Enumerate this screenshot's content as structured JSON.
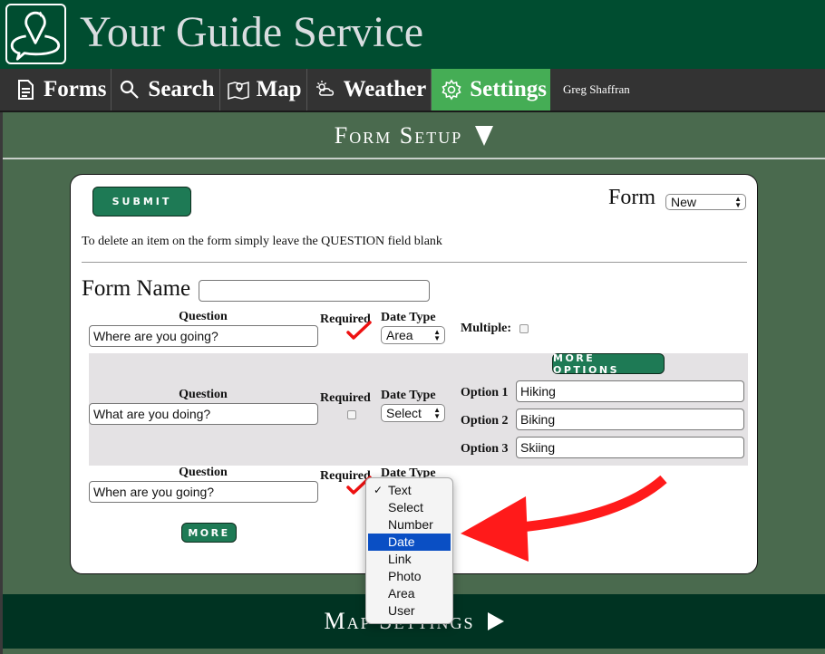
{
  "app": {
    "title": "Your Guide Service",
    "logo_icon": "map-pin-chat-logo"
  },
  "nav": {
    "items": [
      {
        "label": "Forms",
        "icon": "document-icon",
        "active": false
      },
      {
        "label": "Search",
        "icon": "search-icon",
        "active": false
      },
      {
        "label": "Map",
        "icon": "map-icon",
        "active": false
      },
      {
        "label": "Weather",
        "icon": "weather-icon",
        "active": false
      },
      {
        "label": "Settings",
        "icon": "gear-icon",
        "active": true
      }
    ],
    "user_name": "Greg Shaffran",
    "active_color": "#45ad55"
  },
  "sections": {
    "form_setup": {
      "label": "Form Setup",
      "state": "expanded"
    },
    "map_settings": {
      "label": "Map Settings",
      "state": "collapsed"
    }
  },
  "form_setup": {
    "submit_label": "SUBMIT",
    "form_select_label": "Form",
    "form_select_value": "New",
    "delete_note": "To delete an item on the form simply leave the QUESTION field blank",
    "form_name_label": "Form Name",
    "form_name_value": "",
    "column_labels": {
      "question": "Question",
      "required": "Required",
      "date_type": "Date Type",
      "multiple": "Multiple:"
    },
    "questions": [
      {
        "question": "Where are you going?",
        "required": true,
        "date_type": "Area",
        "multiple": false
      },
      {
        "question": "What are you doing?",
        "required": false,
        "date_type": "Select",
        "more_options_label": "MORE OPTIONS",
        "options": [
          {
            "label": "Option 1",
            "value": "Hiking"
          },
          {
            "label": "Option 2",
            "value": "Biking"
          },
          {
            "label": "Option 3",
            "value": "Skiing"
          }
        ]
      },
      {
        "question": "When are you going?",
        "required": true,
        "date_type": "Text"
      }
    ],
    "more_label": "MORE",
    "button_color": "#1e7a55"
  },
  "date_type_dropdown": {
    "open": true,
    "selected": "Text",
    "highlighted": "Date",
    "options": [
      "Text",
      "Select",
      "Number",
      "Date",
      "Link",
      "Photo",
      "Area",
      "User"
    ]
  },
  "annotations": {
    "arrow_color": "#ff1a1a",
    "checkmark_color": "#ee1111"
  }
}
